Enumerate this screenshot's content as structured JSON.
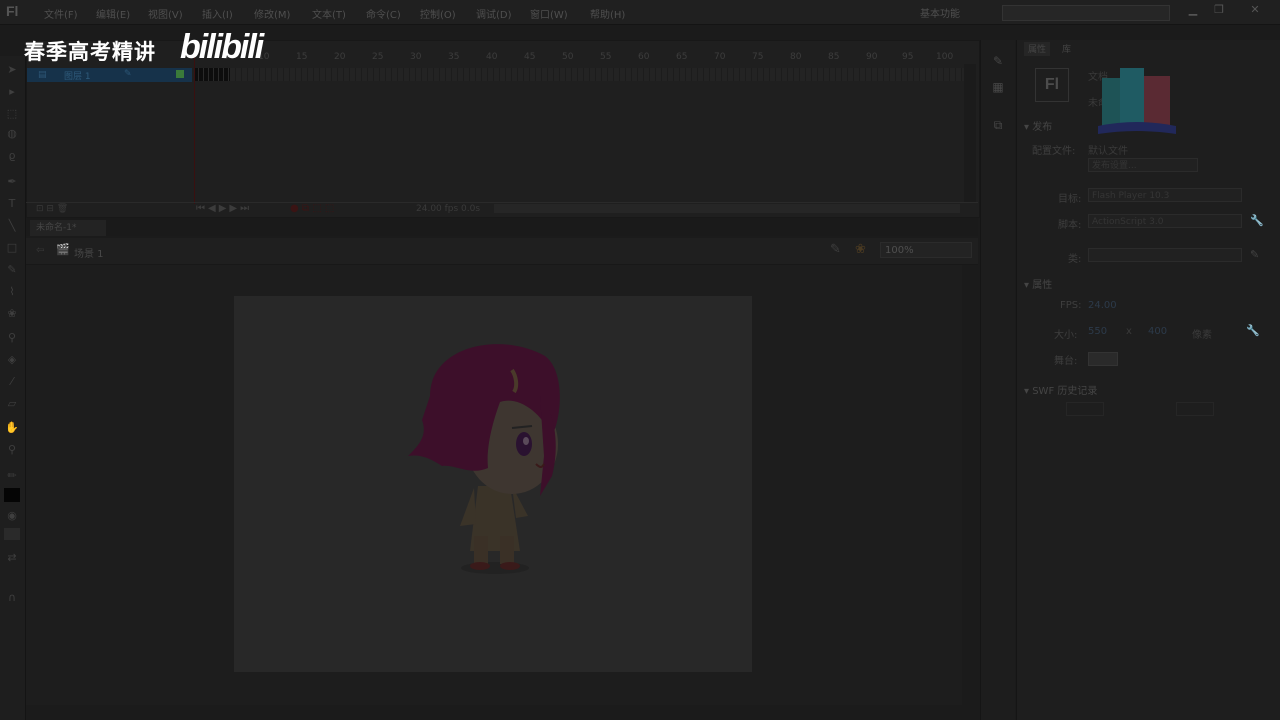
{
  "app": {
    "logo": "Fl",
    "workspace": "基本功能"
  },
  "menu": [
    "文件(F)",
    "编辑(E)",
    "视图(V)",
    "插入(I)",
    "修改(M)",
    "文本(T)",
    "命令(C)",
    "控制(O)",
    "调试(D)",
    "窗口(W)",
    "帮助(H)"
  ],
  "watermark": {
    "text": "春季高考精讲",
    "logo": "bilibili"
  },
  "timeline": {
    "frame_numbers": [
      "5",
      "10",
      "15",
      "20",
      "25",
      "30",
      "35",
      "40",
      "45",
      "50",
      "55",
      "60",
      "65",
      "70",
      "75",
      "80",
      "85",
      "90",
      "95",
      "100"
    ],
    "layer_name": "图层 1",
    "status": "24.00 fps  0.0s"
  },
  "document": {
    "tab": "未命名-1*",
    "scene": "场景 1",
    "zoom": "100%"
  },
  "properties": {
    "tabs": [
      "属性",
      "库"
    ],
    "doc_type": "文档",
    "doc_name": "未命名-1",
    "section_publish": "发布",
    "profile_label": "配置文件:",
    "profile_value": "默认文件",
    "publish_settings": "发布设置...",
    "target_label": "目标:",
    "target_value": "Flash Player 10.3",
    "script_label": "脚本:",
    "script_value": "ActionScript 3.0",
    "class_label": "类:",
    "section_props": "属性",
    "fps_label": "FPS:",
    "fps_value": "24.00",
    "size_label": "大小:",
    "width": "550",
    "height": "400",
    "px": "像素",
    "stage_label": "舞台:",
    "section_swf": "SWF 历史记录"
  }
}
